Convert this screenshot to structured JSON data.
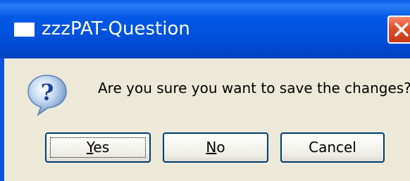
{
  "window": {
    "title": "zzzPAT-Question",
    "close_label": "Close"
  },
  "dialog": {
    "icon": "question-icon",
    "message": "Are you sure you want to save the changes?"
  },
  "buttons": {
    "yes": {
      "mnemonic": "Y",
      "rest": "es"
    },
    "no": {
      "mnemonic": "N",
      "rest": "o"
    },
    "cancel": {
      "label": "Cancel"
    }
  },
  "colors": {
    "titlebar": "#0054e3",
    "dialog_bg": "#ece9d8",
    "close_button": "#e2502a",
    "button_border": "#003c74"
  }
}
